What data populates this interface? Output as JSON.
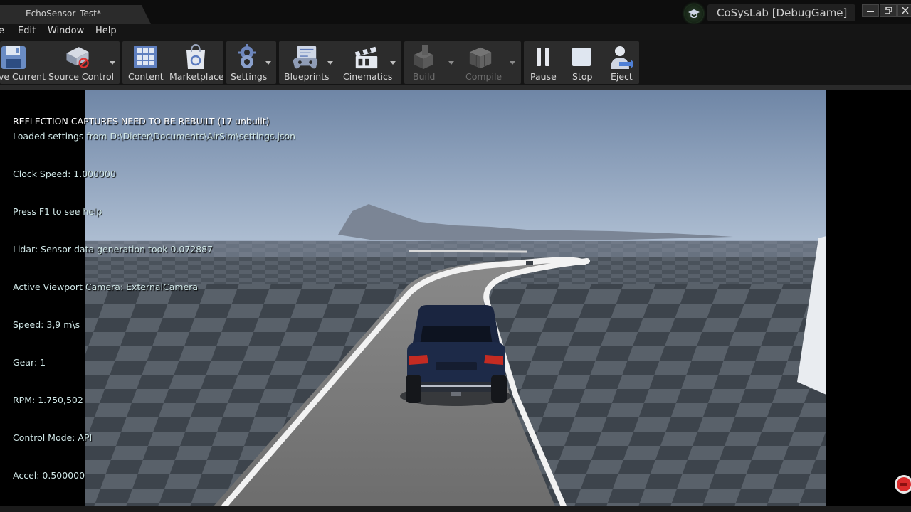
{
  "window": {
    "tab_title": "EchoSensor_Test*",
    "brand_label": "CoSysLab [DebugGame]"
  },
  "menu": {
    "items": [
      "e",
      "Edit",
      "Window",
      "Help"
    ]
  },
  "toolbar": {
    "buttons": [
      {
        "label": "ve Current",
        "icon": "save-icon"
      },
      {
        "label": "Source Control",
        "icon": "source-control-icon"
      },
      {
        "label": "Content",
        "icon": "content-icon"
      },
      {
        "label": "Marketplace",
        "icon": "marketplace-icon"
      },
      {
        "label": "Settings",
        "icon": "settings-icon"
      },
      {
        "label": "Blueprints",
        "icon": "blueprints-icon"
      },
      {
        "label": "Cinematics",
        "icon": "cinematics-icon"
      },
      {
        "label": "Build",
        "icon": "build-icon"
      },
      {
        "label": "Compile",
        "icon": "compile-icon"
      },
      {
        "label": "Pause",
        "icon": "pause-icon"
      },
      {
        "label": "Stop",
        "icon": "stop-icon"
      },
      {
        "label": "Eject",
        "icon": "eject-icon"
      }
    ]
  },
  "viewport": {
    "messages": {
      "reflection": "REFLECTION CAPTURES NEED TO BE REBUILT (17 unbuilt)",
      "settings": "Loaded settings from D:\\Dieter\\Documents\\AirSim\\settings.json",
      "clock": "Clock Speed: 1.000000",
      "help": "Press F1 to see help",
      "lidar": "Lidar: Sensor data generation took 0.072887",
      "camera": "Active Viewport Camera: ExternalCamera",
      "speed": "Speed: 3,9 m\\s",
      "gear": "Gear: 1",
      "rpm": "RPM: 1.750,502",
      "control": "Control Mode: API",
      "accel": "Accel: 0.500000"
    }
  },
  "colors": {
    "background": "#0c0c0c",
    "toolbar_group": "#2c2c2c",
    "sky_top": "#6f86a6",
    "sky_horizon": "#aebed2",
    "ground_dark": "#3c434b",
    "ground_light": "#58606a",
    "road": "#7a7a7a",
    "road_line": "#f2f2f2",
    "car_body": "#1a2540",
    "tail_light": "#c42b22",
    "record_red": "#d92b2b"
  }
}
